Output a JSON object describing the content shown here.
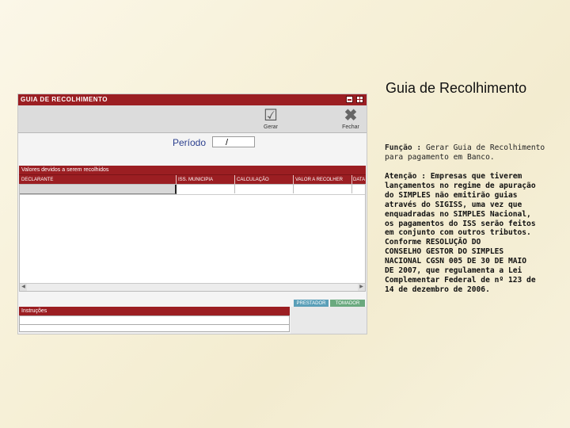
{
  "slide": {
    "title": "Guia de Recolhimento",
    "funcao_label": "Função :",
    "funcao_text": "Gerar Guia de Recolhimento para pagamento em Banco.",
    "atencao_text": "Atenção : Empresas que tiverem\nlançamentos no regime de apuração\ndo SIMPLES não emitirão guias\natravés do SIGISS, uma vez que\nenquadradas no SIMPLES Nacional,\nos pagamentos do ISS serão feitos\nem conjunto com outros tributos.\nConforme RESOLUÇÃO DO\nCONSELHO GESTOR DO SIMPLES\nNACIONAL CGSN 005 DE 30 DE MAIO\nDE 2007, que regulamenta a Lei\nComplementar Federal de nº 123 de\n14 de dezembro de 2006."
  },
  "screenshot": {
    "window_title": "GUIA DE RECOLHIMENTO",
    "toolbar": {
      "gerar_label": "Gerar",
      "fechar_label": "Fechar"
    },
    "periodo": {
      "label": "Período",
      "value": "/"
    },
    "grid": {
      "title": "Valores devidos a serem recolhidos",
      "columns": [
        "DECLARANTE",
        "ISS. MUNICIPIA",
        "CALCULAÇÃO",
        "VALOR A RECOLHER",
        "DATA"
      ]
    },
    "buttons": {
      "prestador": "PRESTADOR",
      "tomador": "TOMADOR"
    },
    "instrucoes_title": "Instruções"
  },
  "colors": {
    "brand_red": "#9b1e22",
    "periodo_blue": "#2b3f8e",
    "prestador": "#5a9fb8",
    "tomador": "#6aa97e"
  },
  "icons": [
    "gerar-check-icon",
    "fechar-x-icon",
    "minimize-icon",
    "grid-icon"
  ]
}
